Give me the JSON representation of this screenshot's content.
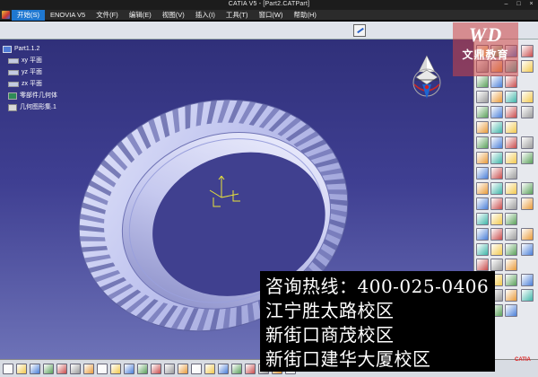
{
  "window": {
    "title": "CATIA V5 - [Part2.CATPart]"
  },
  "menu": {
    "items": [
      "开始(S)",
      "ENOVIA V5",
      "文件(F)",
      "编辑(E)",
      "视图(V)",
      "插入(I)",
      "工具(T)",
      "窗口(W)",
      "帮助(H)"
    ]
  },
  "tree": {
    "root": "Part1.1.2",
    "items": [
      "xy 平面",
      "yz 平面",
      "zx 平面",
      "零部件几何体",
      "几何图形集.1"
    ]
  },
  "logo": {
    "mark": "WD",
    "name": "文鼎教育",
    "color": "#d04444"
  },
  "ad": {
    "lines": [
      "咨询热线：400-025-0406",
      "江宁胜太路校区",
      "新街口商茂校区",
      "新街口建华大厦校区"
    ]
  },
  "brand": {
    "label": "CATIA"
  },
  "colors": {
    "background_top": "#30307a",
    "background_bottom": "#6d72b7",
    "tire": "#c9cdf2"
  }
}
